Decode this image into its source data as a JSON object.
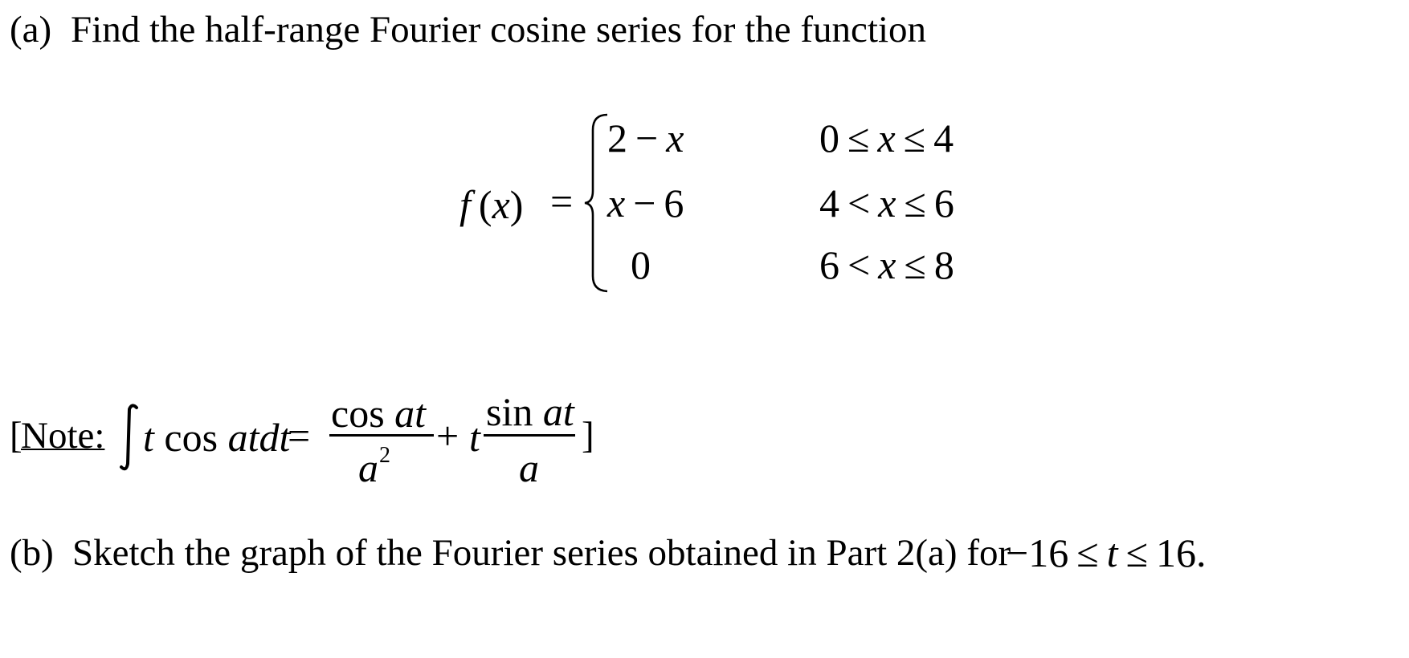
{
  "part_a": {
    "label": "(a)",
    "text": "Find the half-range Fourier cosine series for the function"
  },
  "function_def": {
    "lhs": "f(x)",
    "equals": "=",
    "cases": [
      {
        "expr": "2 − x",
        "condition": "0 ≤ x ≤ 4"
      },
      {
        "expr": "x − 6",
        "condition": "4 < x ≤ 6"
      },
      {
        "expr": "0",
        "condition": "6 < x ≤ 8"
      }
    ]
  },
  "note": {
    "open_bracket": "[",
    "label": "Note:",
    "integral_sign": "∫",
    "integrand": "t cos atdt",
    "equals": "=",
    "frac1_num": "cos at",
    "frac1_den": "a",
    "frac1_den_exp": "2",
    "plus": "+",
    "t_coef": "t",
    "frac2_num": "sin at",
    "frac2_den": "a",
    "close_bracket": "]"
  },
  "part_b": {
    "label": "(b)",
    "text": "Sketch the graph of the Fourier series obtained in Part 2(a) for",
    "range": "−16 ≤ t ≤ 16."
  }
}
